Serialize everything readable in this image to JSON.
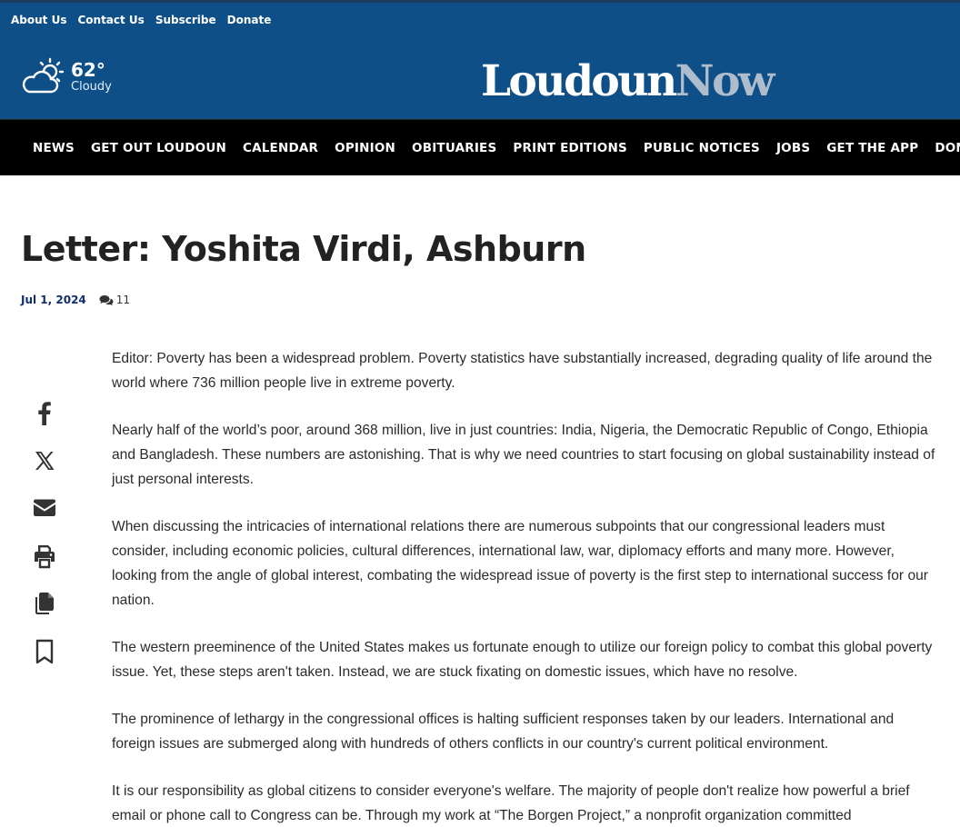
{
  "top_links": [
    "About Us",
    "Contact Us",
    "Subscribe",
    "Donate"
  ],
  "weather": {
    "temperature": "62°",
    "condition": "Cloudy",
    "icon": "partly-cloudy-icon"
  },
  "logo": {
    "part1": "Loudoun",
    "part2": "Now"
  },
  "nav": {
    "home_icon": "home-icon",
    "items": [
      "NEWS",
      "GET OUT LOUDOUN",
      "CALENDAR",
      "OPINION",
      "OBITUARIES",
      "PRINT EDITIONS",
      "PUBLIC NOTICES",
      "JOBS",
      "GET THE APP",
      "DONATE"
    ]
  },
  "article": {
    "title": "Letter: Yoshita Virdi, Ashburn",
    "date": "Jul 1, 2024",
    "comment_count": "11",
    "paragraphs": [
      "Editor: Poverty has been a widespread problem. Poverty statistics have substantially increased, degrading quality of life around the world where 736 million people live in extreme poverty.",
      "Nearly half of the world’s poor, around 368 million, live in just countries: India, Nigeria, the Democratic Republic of Congo, Ethiopia and Bangladesh. These numbers are astonishing. That is why we need countries to start focusing on global sustainability instead of just personal interests.",
      "When discussing the intricacies of international relations there are numerous subpoints that our congressional leaders must consider, including economic policies, cultural differences, international law, war, diplomacy efforts and many more. However, looking from the angle of global interest, combating the widespread issue of poverty is the first step to international success for our nation.",
      "The western preeminence of the United States makes us fortunate enough to utilize our foreign policy to combat this global poverty issue. Yet, these steps aren't taken. Instead, we are stuck fixating on domestic issues, which have no resolve.",
      "The prominence of lethargy in the congressional offices is halting sufficient responses taken by our leaders. International and foreign issues are submerged along with hundreds of others conflicts in our country's current political environment.",
      "It is our responsibility as global citizens to consider everyone's welfare. The majority of people don't realize how powerful a brief email or phone call to Congress can be. Through my work at “The Borgen Project,” a nonprofit organization committed"
    ]
  },
  "share_icons": [
    "facebook-icon",
    "x-icon",
    "email-icon",
    "print-icon",
    "copy-icon",
    "bookmark-icon"
  ],
  "colors": {
    "header": "#0e4f88",
    "nav": "#000000",
    "date": "#0f2e6e",
    "logo_secondary": "#aebccb"
  }
}
